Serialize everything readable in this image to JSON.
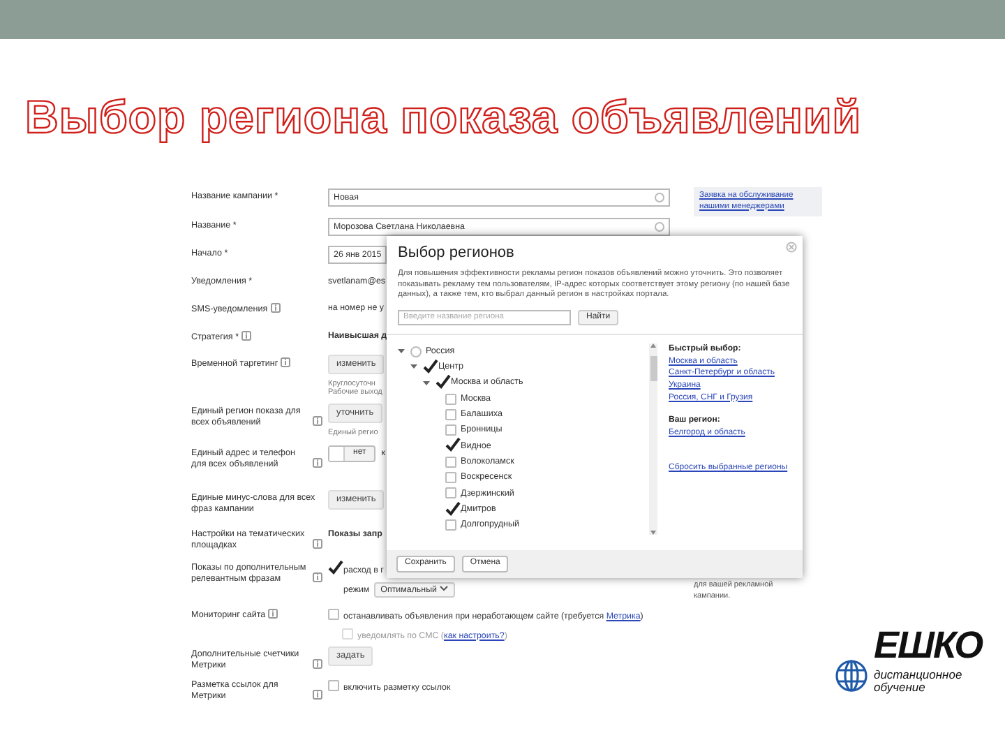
{
  "slide": {
    "title": "Выбор региона показа объявлений",
    "logo": {
      "name": "ЕШКО",
      "tagline": [
        "дистанционное",
        "обучение"
      ]
    }
  },
  "form": {
    "manager_link": [
      "Заявка на обслуживание",
      "нашими менеджерами"
    ],
    "rows": [
      {
        "label": "Название кампании *",
        "help": false,
        "kind": "input",
        "value": "Новая"
      },
      {
        "label": "Название *",
        "help": false,
        "kind": "input",
        "value": "Морозова Светлана Николаевна"
      },
      {
        "label": "Начало *",
        "help": false,
        "kind": "date",
        "value": "26 янв 2015"
      },
      {
        "label": "Уведомления *",
        "help": false,
        "kind": "text",
        "value": "svetlanam@es"
      },
      {
        "label": "SMS-уведомления",
        "help": true,
        "kind": "text",
        "value": "на номер не у"
      },
      {
        "label": "Стратегия *",
        "help": true,
        "kind": "strong",
        "value": "Наивысшая д"
      },
      {
        "label": "Временной таргетинг",
        "help": true,
        "kind": "button",
        "value": "изменить",
        "notes": [
          "Круглосуточн",
          "Рабочие выход"
        ]
      },
      {
        "label": "Единый регион показа для всех объявлений",
        "help": true,
        "kind": "button",
        "value": "уточнить",
        "notes": [
          "Единый регио"
        ]
      },
      {
        "label": "Единый адрес и телефон для всех объявлений",
        "help": true,
        "kind": "toggle",
        "value": "нет",
        "on": false,
        "after": "к"
      },
      {
        "label": "Единые минус-слова для всех фраз кампании",
        "help": false,
        "kind": "button",
        "value": "изменить"
      },
      {
        "label": "Настройки на тематических площадках",
        "help": true,
        "kind": "strong",
        "value": "Показы запр"
      },
      {
        "label": "Показы по дополнительным релевантным фразам",
        "help": true,
        "kind": "checkbox",
        "checked": true,
        "disabled": false,
        "value": "расход в г",
        "mode_label": "режим",
        "mode": "Оптимальный",
        "aside": [
          "для вашей рекламной",
          "кампании."
        ]
      },
      {
        "label": "Мониторинг сайта",
        "help": true,
        "kind": "checkbox",
        "checked": false,
        "disabled": false,
        "value": "останавливать объявления при неработающем сайте (требуется ",
        "link": "Метрика",
        "tail": ")",
        "sub": {
          "checked": false,
          "disabled": true,
          "value": "уведомлять по СМС (",
          "link": "как настроить?",
          "tail": ")"
        }
      },
      {
        "label": "Дополнительные счетчики Метрики",
        "help": true,
        "kind": "button",
        "value": "задать"
      },
      {
        "label": "Разметка ссылок для Метрики",
        "help": true,
        "kind": "checkbox",
        "checked": false,
        "disabled": false,
        "value": "включить разметку ссылок"
      }
    ]
  },
  "modal": {
    "title": "Выбор регионов",
    "description": "Для повышения эффективности рекламы регион показов объявлений можно уточнить. Это позволяет показывать рекламу тем пользователям, IP-адрес которых соответствует этому региону (по нашей базе данных), а также тем, кто выбрал данный регион в настройках портала.",
    "search": {
      "placeholder": "Введите название региона",
      "button": "Найти"
    },
    "tree": [
      {
        "label": "Россия",
        "kind": "radio",
        "checked": false,
        "expanded": true,
        "children": [
          {
            "label": "Центр",
            "kind": "checkbox",
            "checked": true,
            "expanded": true,
            "children": [
              {
                "label": "Москва и область",
                "kind": "checkbox",
                "checked": true,
                "expanded": true,
                "children": [
                  {
                    "label": "Москва",
                    "kind": "checkbox",
                    "checked": false
                  },
                  {
                    "label": "Балашиха",
                    "kind": "checkbox",
                    "checked": false
                  },
                  {
                    "label": "Бронницы",
                    "kind": "checkbox",
                    "checked": false
                  },
                  {
                    "label": "Видное",
                    "kind": "checkbox",
                    "checked": true
                  },
                  {
                    "label": "Волоколамск",
                    "kind": "checkbox",
                    "checked": false
                  },
                  {
                    "label": "Воскресенск",
                    "kind": "checkbox",
                    "checked": false
                  },
                  {
                    "label": "Дзержинский",
                    "kind": "checkbox",
                    "checked": false
                  },
                  {
                    "label": "Дмитров",
                    "kind": "checkbox",
                    "checked": true
                  },
                  {
                    "label": "Долгопрудный",
                    "kind": "checkbox",
                    "checked": false
                  }
                ]
              }
            ]
          }
        ]
      }
    ],
    "quick_title": "Быстрый выбор:",
    "quick_links": [
      "Москва и область",
      "Санкт-Петербург и область",
      "Украина",
      "Россия, СНГ и Грузия"
    ],
    "your_region_title": "Ваш регион:",
    "your_region": "Белгород и область",
    "reset": "Сбросить выбранные регионы",
    "buttons": [
      "Сохранить",
      "Отмена"
    ]
  }
}
